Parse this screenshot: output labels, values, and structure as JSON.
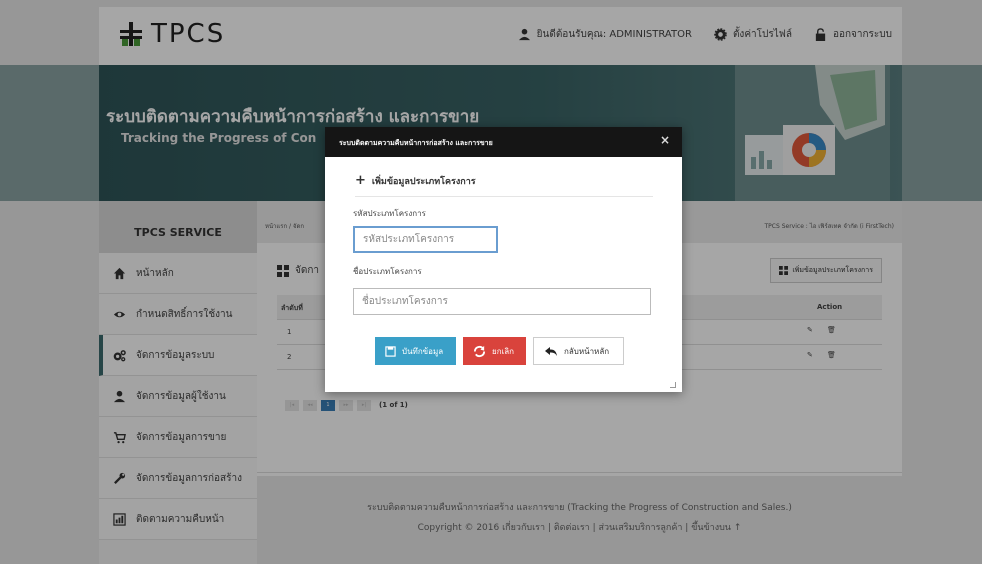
{
  "header": {
    "logo_text": "TPCS",
    "welcome": "ยินดีต้อนรับคุณ: ADMINISTRATOR",
    "profile": "ตั้งค่าโปรไฟล์",
    "logout": "ออกจากระบบ"
  },
  "banner": {
    "title": "ระบบติดตามความคืบหน้าการก่อสร้าง และการขาย",
    "subtitle": "Tracking the Progress of Con"
  },
  "sidebar": {
    "heading": "TPCS SERVICE",
    "items": [
      {
        "label": "หน้าหลัก",
        "icon": "home-icon"
      },
      {
        "label": "กำหนดสิทธิ์การใช้งาน",
        "icon": "eye-icon"
      },
      {
        "label": "จัดการข้อมูลระบบ",
        "icon": "cogs-icon"
      },
      {
        "label": "จัดการข้อมูลผู้ใช้งาน",
        "icon": "user-icon"
      },
      {
        "label": "จัดการข้อมูลการขาย",
        "icon": "cart-icon"
      },
      {
        "label": "จัดการข้อมูลการก่อสร้าง",
        "icon": "wrench-icon"
      },
      {
        "label": "ติดตามความคืบหน้า",
        "icon": "chart-icon"
      }
    ]
  },
  "content": {
    "breadcrumb": "หน้าแรก / จัดก",
    "breadcrumb_right": "TPCS Service : ไอ เฟิร์สเทค จำกัด (i FirstTech)",
    "section_title": "จัดกา",
    "add_button": "เพิ่มข้อมูลประเภทโครงการ",
    "table": {
      "col_no": "ลำดับที่",
      "col_action": "Action",
      "rows": [
        "1",
        "2"
      ]
    },
    "pager": {
      "current": "1",
      "info": "(1 of 1)"
    }
  },
  "modal": {
    "title": "ระบบติดตามความคืบหน้าการก่อสร้าง และการขาย",
    "close": "×",
    "section": "เพิ่มข้อมูลประเภทโครงการ",
    "code_label": "รหัสประเภทโครงการ",
    "code_placeholder": "รหัสประเภทโครงการ",
    "name_label": "ชื่อประเภทโครงการ",
    "name_placeholder": "ชื่อประเภทโครงการ",
    "save": "บันทึกข้อมูล",
    "cancel": "ยกเลิก",
    "back": "กลับหน้าหลัก"
  },
  "footer": {
    "line1": "ระบบติดตามความคืบหน้าการก่อสร้าง และการขาย  (Tracking the Progress of Construction and Sales.)",
    "line2": "Copyright © 2016  เกี่ยวกับเรา | ติดต่อเรา | ส่วนเสริมบริการลูกค้า | ขึ้นข้างบน ↑"
  },
  "colors": {
    "accent": "#3aa0c8",
    "danger": "#d9433c",
    "banner": "#2f5558"
  }
}
